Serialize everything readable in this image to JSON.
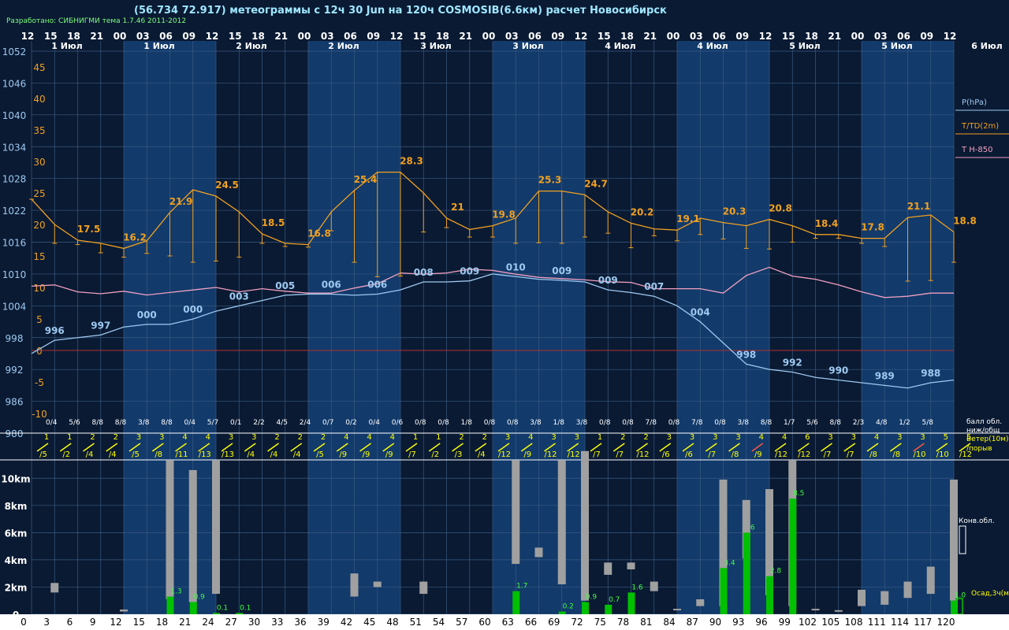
{
  "header": {
    "title": "(56.734 72.917) метеограммы с  12ч 30 Jun на 120ч COSMOSIB(6.6км) расчет Новосибирск",
    "credit": "Разработано: СИБНИГМИ тема 1.7.46 2011-2012"
  },
  "colors": {
    "background": "#0a1a33",
    "day_band": "#123a6b",
    "night_band": "#0a1a33",
    "grid": "#3a5a80",
    "pressure": "#9ec9f0",
    "temperature": "#f0a020",
    "t850": "#f0a0c0",
    "wind": "#ffff00",
    "wind_strong": "#ff5a3a",
    "precip": "#00c000",
    "cloud": "#a0a0a0",
    "zero_line": "#b03030"
  },
  "chart_data": {
    "type": "line",
    "hour_ticks": [
      "12",
      "15",
      "18",
      "21",
      "00",
      "03",
      "06",
      "09",
      "12",
      "15",
      "18",
      "21",
      "00",
      "03",
      "06",
      "09",
      "12",
      "15",
      "18",
      "21",
      "00",
      "03",
      "06",
      "09",
      "12",
      "15",
      "18",
      "21",
      "00",
      "03",
      "06",
      "09",
      "12",
      "15",
      "18",
      "21",
      "00",
      "03",
      "06",
      "09",
      "12"
    ],
    "step_ticks": [
      "0",
      "3",
      "6",
      "9",
      "12",
      "15",
      "18",
      "21",
      "24",
      "27",
      "30",
      "33",
      "36",
      "39",
      "42",
      "45",
      "48",
      "51",
      "54",
      "57",
      "60",
      "63",
      "66",
      "69",
      "72",
      "75",
      "78",
      "81",
      "84",
      "87",
      "90",
      "93",
      "96",
      "99",
      "102",
      "105",
      "108",
      "111",
      "114",
      "117",
      "120"
    ],
    "day_labels": [
      {
        "label": "1 Июл",
        "from": 0
      },
      {
        "label": "1 Июл",
        "from": 4
      },
      {
        "label": "2 Июл",
        "from": 8
      },
      {
        "label": "2 Июл",
        "from": 12
      },
      {
        "label": "3 Июл",
        "from": 16
      },
      {
        "label": "3 Июл",
        "from": 20
      },
      {
        "label": "4 Июл",
        "from": 24
      },
      {
        "label": "4 Июл",
        "from": 28
      },
      {
        "label": "5 Июл",
        "from": 32
      },
      {
        "label": "5 Июл",
        "from": 36
      }
    ],
    "day_last": "6 Июл",
    "pressure_axis": [
      "1052",
      "1046",
      "1040",
      "1034",
      "1028",
      "1022",
      "1016",
      "1010",
      "1004",
      "998",
      "992",
      "986",
      "980"
    ],
    "pressure_range": [
      980,
      1052
    ],
    "temp_axis": [
      "45",
      "40",
      "35",
      "30",
      "25",
      "20",
      "15",
      "10",
      "5",
      "0",
      "-5",
      "-10"
    ],
    "temp_range": [
      -10,
      45
    ],
    "legend": {
      "pressure": "P(hPa)",
      "temperature": "T/TD(2m)",
      "t850": "T H-850"
    },
    "pressure": [
      995,
      997.5,
      998,
      998.5,
      1000,
      1000.5,
      1000.5,
      1001.5,
      1003,
      1004,
      1005,
      1006,
      1006.2,
      1006.2,
      1006,
      1006.2,
      1007,
      1008.5,
      1008.5,
      1008.7,
      1010,
      1009.5,
      1009,
      1008.8,
      1008.5,
      1007,
      1006.5,
      1005.8,
      1004,
      1001,
      997,
      993,
      992,
      991.5,
      990.5,
      990,
      989.5,
      989,
      988.5,
      989.5,
      990
    ],
    "pressure_labels": [
      {
        "i": 1,
        "t": "996"
      },
      {
        "i": 3,
        "t": "997"
      },
      {
        "i": 5,
        "t": "000"
      },
      {
        "i": 7,
        "t": "000"
      },
      {
        "i": 9,
        "t": "003"
      },
      {
        "i": 11,
        "t": "005"
      },
      {
        "i": 13,
        "t": "006"
      },
      {
        "i": 15,
        "t": "006"
      },
      {
        "i": 17,
        "t": "008"
      },
      {
        "i": 19,
        "t": "009"
      },
      {
        "i": 21,
        "t": "010"
      },
      {
        "i": 23,
        "t": "009"
      },
      {
        "i": 25,
        "t": "009"
      },
      {
        "i": 27,
        "t": "007"
      },
      {
        "i": 29,
        "t": "004"
      },
      {
        "i": 31,
        "t": "998"
      },
      {
        "i": 33,
        "t": "992"
      },
      {
        "i": 35,
        "t": "990"
      },
      {
        "i": 37,
        "t": "989"
      },
      {
        "i": 39,
        "t": "988"
      }
    ],
    "t850": [
      10.2,
      10.4,
      9.3,
      9,
      9.4,
      8.8,
      9.2,
      9.6,
      10,
      9.3,
      9.8,
      9.4,
      9.1,
      9.1,
      9.9,
      10.6,
      12.3,
      12.1,
      12.3,
      12.9,
      12.7,
      12.1,
      11.6,
      11.4,
      11.2,
      10.9,
      10.8,
      9.8,
      9.8,
      9.8,
      9.1,
      11.9,
      13.2,
      11.8,
      11.3,
      10.4,
      9.3,
      8.4,
      8.6,
      9.1,
      9.1
    ],
    "temperature": [
      24,
      20,
      17.5,
      17,
      16.2,
      17.4,
      21.9,
      25.5,
      24.5,
      22,
      18.5,
      17,
      16.8,
      22,
      25.4,
      28.3,
      28.3,
      25,
      21,
      19.2,
      19.8,
      21,
      25.3,
      25.3,
      24.7,
      22,
      20.2,
      19.3,
      19.1,
      21,
      20.3,
      19.8,
      20.8,
      19.8,
      18.4,
      18.4,
      17.8,
      17.8,
      21.1,
      21.5,
      18.8
    ],
    "dewpoint": [
      24,
      17,
      16.8,
      15.5,
      14.8,
      15.4,
      15,
      14,
      14.2,
      14.8,
      17,
      16.5,
      16.4,
      19,
      14,
      11.7,
      11.8,
      18.8,
      19.5,
      18,
      18,
      17,
      17.1,
      17,
      18,
      18.6,
      16.3,
      18.2,
      17.4,
      18.4,
      17.7,
      16.2,
      16.1,
      17.2,
      17.8,
      17.8,
      17,
      16.5,
      11,
      11.1,
      14
    ],
    "temp_labels": [
      {
        "i": 2,
        "t": "17.5"
      },
      {
        "i": 4,
        "t": "16.2"
      },
      {
        "i": 6,
        "t": "21.9"
      },
      {
        "i": 8,
        "t": "24.5"
      },
      {
        "i": 10,
        "t": "18.5"
      },
      {
        "i": 12,
        "t": "16.8"
      },
      {
        "i": 14,
        "t": "25.4"
      },
      {
        "i": 16,
        "t": "28.3"
      },
      {
        "i": 18,
        "t": "21"
      },
      {
        "i": 20,
        "t": "19.8"
      },
      {
        "i": 22,
        "t": "25.3"
      },
      {
        "i": 24,
        "t": "24.7"
      },
      {
        "i": 26,
        "t": "20.2"
      },
      {
        "i": 28,
        "t": "19.1"
      },
      {
        "i": 30,
        "t": "20.3"
      },
      {
        "i": 32,
        "t": "20.8"
      },
      {
        "i": 34,
        "t": "18.4"
      },
      {
        "i": 36,
        "t": "17.8"
      },
      {
        "i": 38,
        "t": "21.1"
      },
      {
        "i": 40,
        "t": "18.8"
      }
    ],
    "cloud_fraction": [
      "0/4",
      "5/6",
      "8/8",
      "8/8",
      "3/8",
      "8/8",
      "0/4",
      "5/7",
      "0/1",
      "2/2",
      "4/5",
      "2/4",
      "0/7",
      "0/2",
      "0/4",
      "0/6",
      "0/8",
      "0/8",
      "1/8",
      "0/8",
      "0/8",
      "3/8",
      "1/8",
      "3/8",
      "0/8",
      "0/8",
      "7/8",
      "0/8",
      "7/8",
      "0/8",
      "3/8",
      "8/8",
      "1/7",
      "5/6",
      "8/8",
      "2/3",
      "4/8",
      "1/2",
      "5/8"
    ],
    "cloud_legend": "балл обл.\nниж/общ",
    "wind_legend": "Ветер(10м)\n/порыв",
    "wind_speed": [
      "1",
      "1",
      "2",
      "2",
      "3",
      "3",
      "4",
      "4",
      "3",
      "3",
      "2",
      "2",
      "2",
      "4",
      "4",
      "4",
      "1",
      "1",
      "2",
      "2",
      "3",
      "4",
      "3",
      "3",
      "1",
      "2",
      "2",
      "3",
      "3",
      "3",
      "3",
      "4",
      "4",
      "6",
      "3",
      "3",
      "4",
      "3",
      "3",
      "5",
      "5",
      "4"
    ],
    "wind_gust": [
      "/5",
      "/2",
      "/4",
      "/4",
      "/5",
      "/8",
      "/11",
      "/13",
      "/13",
      "/4",
      "/4",
      "/4",
      "/5",
      "/9",
      "/9",
      "/9",
      "/7",
      "/2",
      "/3",
      "/4",
      "/12",
      "/9",
      "/12",
      "/12",
      "/7",
      "/7",
      "/12",
      "/6",
      "/6",
      "/7",
      "/8",
      "/9",
      "/12",
      "/12",
      "/7",
      "/7",
      "/8",
      "/8",
      "/10",
      "/10",
      "/12"
    ],
    "heights": [
      "10km",
      "8km",
      "6km",
      "4km",
      "2km",
      "0"
    ],
    "height_range": [
      0,
      11
    ],
    "conv_legend": "Конв.обл.",
    "precip_legend": "Осад,3ч(мм)",
    "precip": [
      0,
      0,
      0,
      0,
      0,
      0,
      1.3,
      0.9,
      0.1,
      0.1,
      0,
      0,
      0,
      0,
      0,
      0,
      0,
      0,
      0,
      0,
      0,
      1.7,
      0,
      0.2,
      0.9,
      0.7,
      1.6,
      0,
      0,
      0,
      3.4,
      6,
      2.8,
      8.5,
      0,
      0,
      0,
      0,
      0,
      0,
      1.0
    ],
    "precip_labels": [
      {
        "i": 6,
        "t": "1.3"
      },
      {
        "i": 7,
        "t": "0.9"
      },
      {
        "i": 8,
        "t": "0.1"
      },
      {
        "i": 9,
        "t": "0.1"
      },
      {
        "i": 21,
        "t": "1.7"
      },
      {
        "i": 23,
        "t": "0.2"
      },
      {
        "i": 24,
        "t": "0.9"
      },
      {
        "i": 25,
        "t": "0.7"
      },
      {
        "i": 26,
        "t": "1.6"
      },
      {
        "i": 30,
        "t": "3.4"
      },
      {
        "i": 31,
        "t": "6"
      },
      {
        "i": 32,
        "t": "2.8"
      },
      {
        "i": 33,
        "t": "8.5"
      },
      {
        "i": 40,
        "t": "1.0"
      }
    ],
    "clouds": [
      {
        "i": 1,
        "lo": 1.6,
        "hi": 2.3
      },
      {
        "i": 4,
        "lo": 0.2,
        "hi": 0.35
      },
      {
        "i": 6,
        "lo": 1.1,
        "hi": 11.3
      },
      {
        "i": 7,
        "lo": 0.9,
        "hi": 10.6
      },
      {
        "i": 8,
        "lo": 1.5,
        "hi": 11.3
      },
      {
        "i": 14,
        "lo": 1.3,
        "hi": 3.0
      },
      {
        "i": 15,
        "lo": 2.0,
        "hi": 2.4
      },
      {
        "i": 17,
        "lo": 1.5,
        "hi": 2.4
      },
      {
        "i": 21,
        "lo": 3.7,
        "hi": 11.3
      },
      {
        "i": 22,
        "lo": 4.2,
        "hi": 4.9
      },
      {
        "i": 23,
        "lo": 2.2,
        "hi": 11.3
      },
      {
        "i": 24,
        "lo": 1.0,
        "hi": 12.0
      },
      {
        "i": 25,
        "lo": 2.9,
        "hi": 3.8
      },
      {
        "i": 26,
        "lo": 3.3,
        "hi": 3.8
      },
      {
        "i": 27,
        "lo": 1.7,
        "hi": 2.4
      },
      {
        "i": 28,
        "lo": 0.3,
        "hi": 0.4
      },
      {
        "i": 29,
        "lo": 0.6,
        "hi": 1.1
      },
      {
        "i": 30,
        "lo": 0.6,
        "hi": 9.9
      },
      {
        "i": 31,
        "lo": 4.1,
        "hi": 8.4
      },
      {
        "i": 32,
        "lo": 1.4,
        "hi": 9.2
      },
      {
        "i": 33,
        "lo": 0.6,
        "hi": 11.3
      },
      {
        "i": 34,
        "lo": 0.3,
        "hi": 0.4
      },
      {
        "i": 35,
        "lo": 0.2,
        "hi": 0.3
      },
      {
        "i": 36,
        "lo": 0.6,
        "hi": 1.8
      },
      {
        "i": 37,
        "lo": 0.7,
        "hi": 1.7
      },
      {
        "i": 38,
        "lo": 1.2,
        "hi": 2.4
      },
      {
        "i": 39,
        "lo": 1.5,
        "hi": 3.5
      },
      {
        "i": 40,
        "lo": 1.0,
        "hi": 9.9
      }
    ]
  }
}
